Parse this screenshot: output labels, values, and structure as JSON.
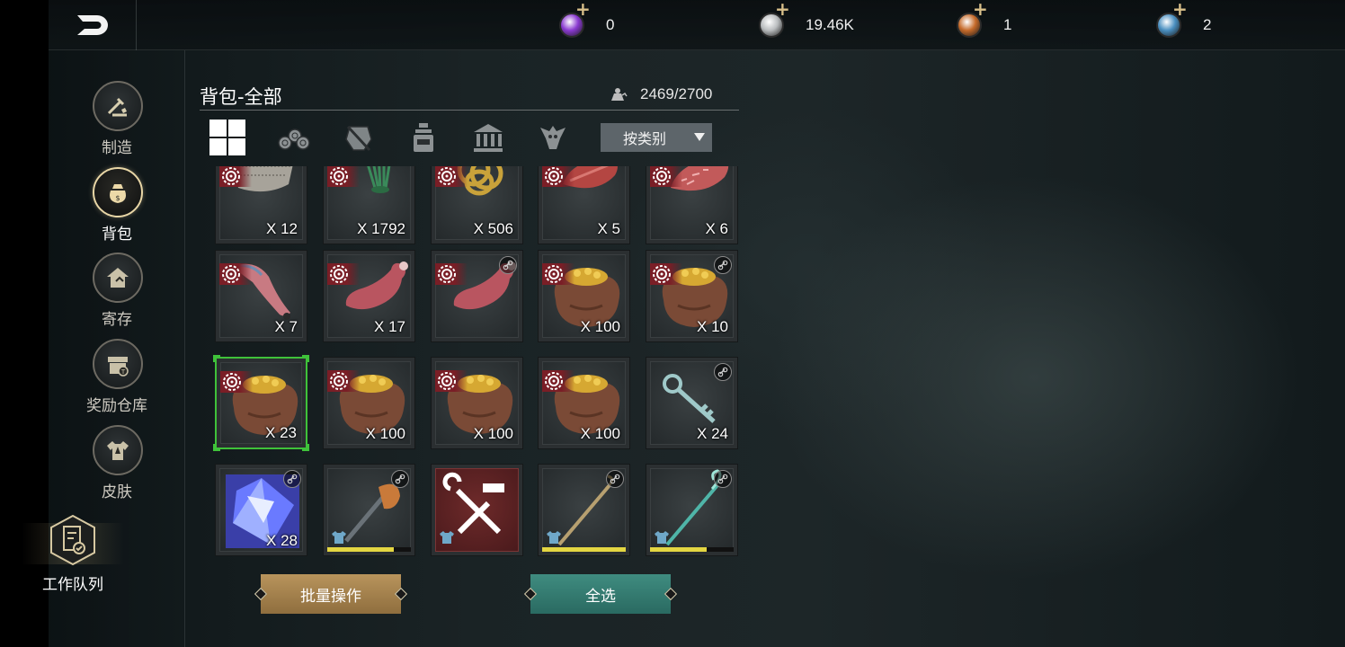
{
  "currencies": [
    {
      "name": "purple-gem",
      "value": "0",
      "color": "#8a3ad0"
    },
    {
      "name": "silver-coin",
      "value": "19.46K",
      "color": "#b9bcbe"
    },
    {
      "name": "bronze-coin",
      "value": "1",
      "color": "#c56a2a"
    },
    {
      "name": "blue-gem",
      "value": "2",
      "color": "#4a8fc0"
    }
  ],
  "sidebar": {
    "items": [
      {
        "label": "制造",
        "icon": "crafting-icon"
      },
      {
        "label": "背包",
        "icon": "bag-icon"
      },
      {
        "label": "寄存",
        "icon": "storage-icon"
      },
      {
        "label": "奖励仓库",
        "icon": "reward-warehouse-icon"
      },
      {
        "label": "皮肤",
        "icon": "skin-icon"
      }
    ],
    "queue_label": "工作队列"
  },
  "header": {
    "title": "背包-全部",
    "capacity": "2469/2700"
  },
  "filter": {
    "tabs": [
      "all-icon",
      "wood-icon",
      "hide-icon",
      "potion-icon",
      "building-icon",
      "creature-icon"
    ],
    "sort_label": "按类别"
  },
  "items": [
    {
      "kind": "chainmail",
      "qty": "X 12",
      "badge": true
    },
    {
      "kind": "herb",
      "qty": "X 1792",
      "badge": true
    },
    {
      "kind": "rope",
      "qty": "X 506",
      "badge": true
    },
    {
      "kind": "meat",
      "qty": "X 5",
      "badge": true
    },
    {
      "kind": "meat-marbled",
      "qty": "X 6",
      "badge": true
    },
    {
      "kind": "claw",
      "qty": "X 7",
      "badge": true
    },
    {
      "kind": "leg-meat",
      "qty": "X 17",
      "badge": true
    },
    {
      "kind": "leg-meat",
      "qty": "",
      "badge": true,
      "link": true
    },
    {
      "kind": "coin-bag",
      "qty": "X 100",
      "badge": true
    },
    {
      "kind": "coin-bag",
      "qty": "X 10",
      "badge": true,
      "link": true
    },
    {
      "kind": "coin-bag",
      "qty": "X 23",
      "badge": true,
      "selected": true
    },
    {
      "kind": "coin-bag",
      "qty": "X 100",
      "badge": true
    },
    {
      "kind": "coin-bag",
      "qty": "X 100",
      "badge": true
    },
    {
      "kind": "coin-bag",
      "qty": "X 100",
      "badge": true
    },
    {
      "kind": "key",
      "qty": "X 24",
      "link": true
    },
    {
      "kind": "crystal",
      "qty": "X 28",
      "link": true
    },
    {
      "kind": "axe",
      "link": true,
      "durability": 0.8
    },
    {
      "kind": "tools",
      "red": true
    },
    {
      "kind": "staff",
      "link": true,
      "durability": 1.0
    },
    {
      "kind": "staff-blue",
      "link": true,
      "durability": 0.68
    }
  ],
  "buttons": {
    "batch": "批量操作",
    "select_all": "全选"
  }
}
